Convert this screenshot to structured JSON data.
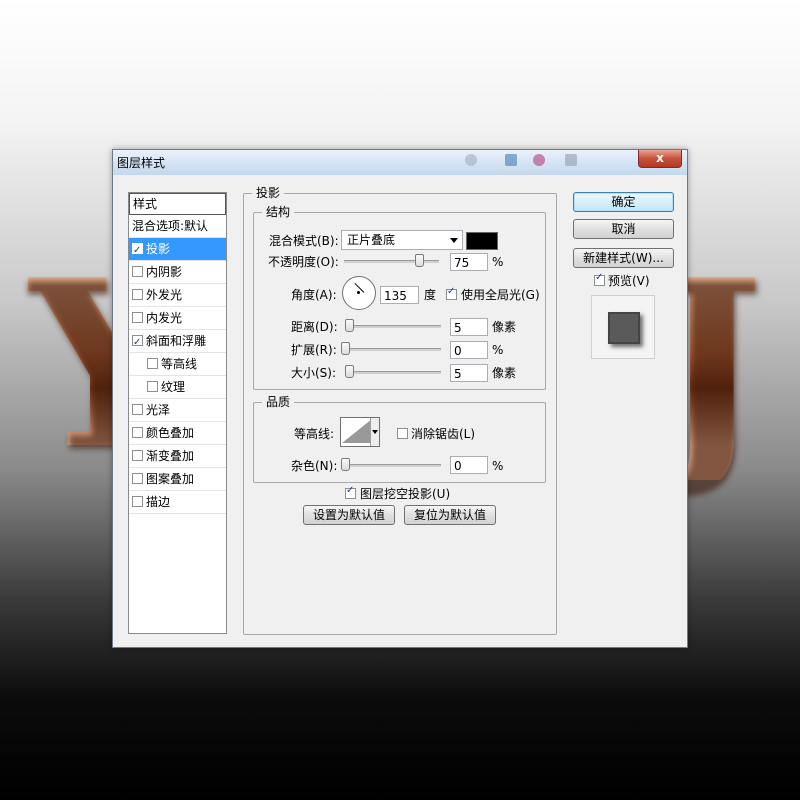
{
  "window": {
    "title": "图层样式",
    "close_glyph": "x"
  },
  "style_list": {
    "header": "样式",
    "items": [
      {
        "label": "混合选项:默认",
        "checkbox": false,
        "checked": false,
        "indent": false,
        "selected": false
      },
      {
        "label": "投影",
        "checkbox": true,
        "checked": true,
        "indent": false,
        "selected": true
      },
      {
        "label": "内阴影",
        "checkbox": true,
        "checked": false,
        "indent": false,
        "selected": false
      },
      {
        "label": "外发光",
        "checkbox": true,
        "checked": false,
        "indent": false,
        "selected": false
      },
      {
        "label": "内发光",
        "checkbox": true,
        "checked": false,
        "indent": false,
        "selected": false
      },
      {
        "label": "斜面和浮雕",
        "checkbox": true,
        "checked": true,
        "indent": false,
        "selected": false
      },
      {
        "label": "等高线",
        "checkbox": true,
        "checked": false,
        "indent": true,
        "selected": false
      },
      {
        "label": "纹理",
        "checkbox": true,
        "checked": false,
        "indent": true,
        "selected": false
      },
      {
        "label": "光泽",
        "checkbox": true,
        "checked": false,
        "indent": false,
        "selected": false
      },
      {
        "label": "颜色叠加",
        "checkbox": true,
        "checked": false,
        "indent": false,
        "selected": false
      },
      {
        "label": "渐变叠加",
        "checkbox": true,
        "checked": false,
        "indent": false,
        "selected": false
      },
      {
        "label": "图案叠加",
        "checkbox": true,
        "checked": false,
        "indent": false,
        "selected": false
      },
      {
        "label": "描边",
        "checkbox": true,
        "checked": false,
        "indent": false,
        "selected": false
      }
    ]
  },
  "panel": {
    "title": "投影",
    "structure": {
      "title": "结构",
      "blend_mode_label": "混合模式(B):",
      "blend_mode_value": "正片叠底",
      "shadow_color": "#000000",
      "opacity_label": "不透明度(O):",
      "opacity_value": "75",
      "opacity_unit": "%",
      "angle_label": "角度(A):",
      "angle_value": "135",
      "angle_unit": "度",
      "global_light_label": "使用全局光(G)",
      "global_light_checked": true,
      "distance_label": "距离(D):",
      "distance_value": "5",
      "distance_unit": "像素",
      "spread_label": "扩展(R):",
      "spread_value": "0",
      "spread_unit": "%",
      "size_label": "大小(S):",
      "size_value": "5",
      "size_unit": "像素"
    },
    "quality": {
      "title": "品质",
      "contour_label": "等高线:",
      "anti_alias_label": "消除锯齿(L)",
      "anti_alias_checked": false,
      "noise_label": "杂色(N):",
      "noise_value": "0",
      "noise_unit": "%"
    },
    "knockout_label": "图层挖空投影(U)",
    "knockout_checked": true,
    "make_default_label": "设置为默认值",
    "reset_default_label": "复位为默认值"
  },
  "buttons": {
    "ok": "确定",
    "cancel": "取消",
    "new_style": "新建样式(W)...",
    "preview_label": "预览(V)",
    "preview_checked": true
  },
  "colors": {
    "selection": "#3399ff",
    "titlebar": "#d5e4f4",
    "close_button": "#c7503a"
  }
}
